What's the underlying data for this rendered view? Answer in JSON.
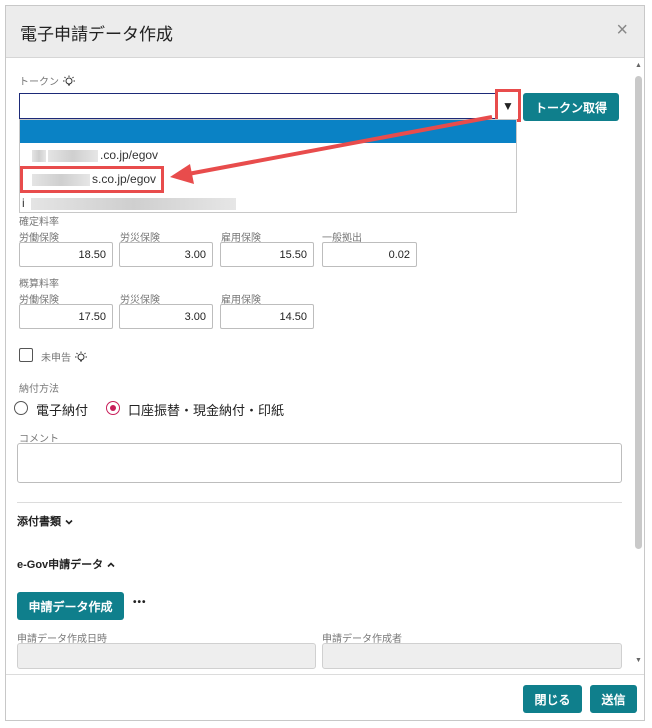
{
  "dialog": {
    "title": "電子申請データ作成",
    "close_icon": "×"
  },
  "token": {
    "label": "トークン",
    "input_value": "",
    "dropdown_arrow": "▼",
    "fetch_button": "トークン取得",
    "options": [
      {
        "suffix": ".co.jp/egov"
      },
      {
        "suffix": "s.co.jp/egov"
      },
      {
        "suffix": "i"
      }
    ]
  },
  "confirmed_rates": {
    "label": "確定料率",
    "fields": [
      {
        "label": "労働保険",
        "value": "18.50"
      },
      {
        "label": "労災保険",
        "value": "3.00"
      },
      {
        "label": "雇用保険",
        "value": "15.50"
      },
      {
        "label": "一般拠出",
        "value": "0.02"
      }
    ]
  },
  "estimated_rates": {
    "label": "概算料率",
    "fields": [
      {
        "label": "労働保険",
        "value": "17.50"
      },
      {
        "label": "労災保険",
        "value": "3.00"
      },
      {
        "label": "雇用保険",
        "value": "14.50"
      }
    ]
  },
  "unfiled": {
    "label": "未申告"
  },
  "payment": {
    "label": "納付方法",
    "options": [
      {
        "label": "電子納付",
        "selected": false
      },
      {
        "label": "口座振替・現金納付・印紙",
        "selected": true
      }
    ]
  },
  "comment": {
    "label": "コメント",
    "value": ""
  },
  "attachments": {
    "title": "添付書類",
    "toggle_icon": "chevron-down-icon"
  },
  "egov": {
    "title": "e-Gov申請データ",
    "toggle_icon": "chevron-up-icon",
    "create_button": "申請データ作成",
    "more_icon": "•••",
    "created_at_label": "申請データ作成日時",
    "created_by_label": "申請データ作成者"
  },
  "footer": {
    "close_button": "閉じる",
    "send_button": "送信"
  },
  "colors": {
    "primary": "#0f7f8c",
    "selected_option": "#0a82c5",
    "annotation": "#e84c4c",
    "radio_selected": "#c81e5a"
  }
}
